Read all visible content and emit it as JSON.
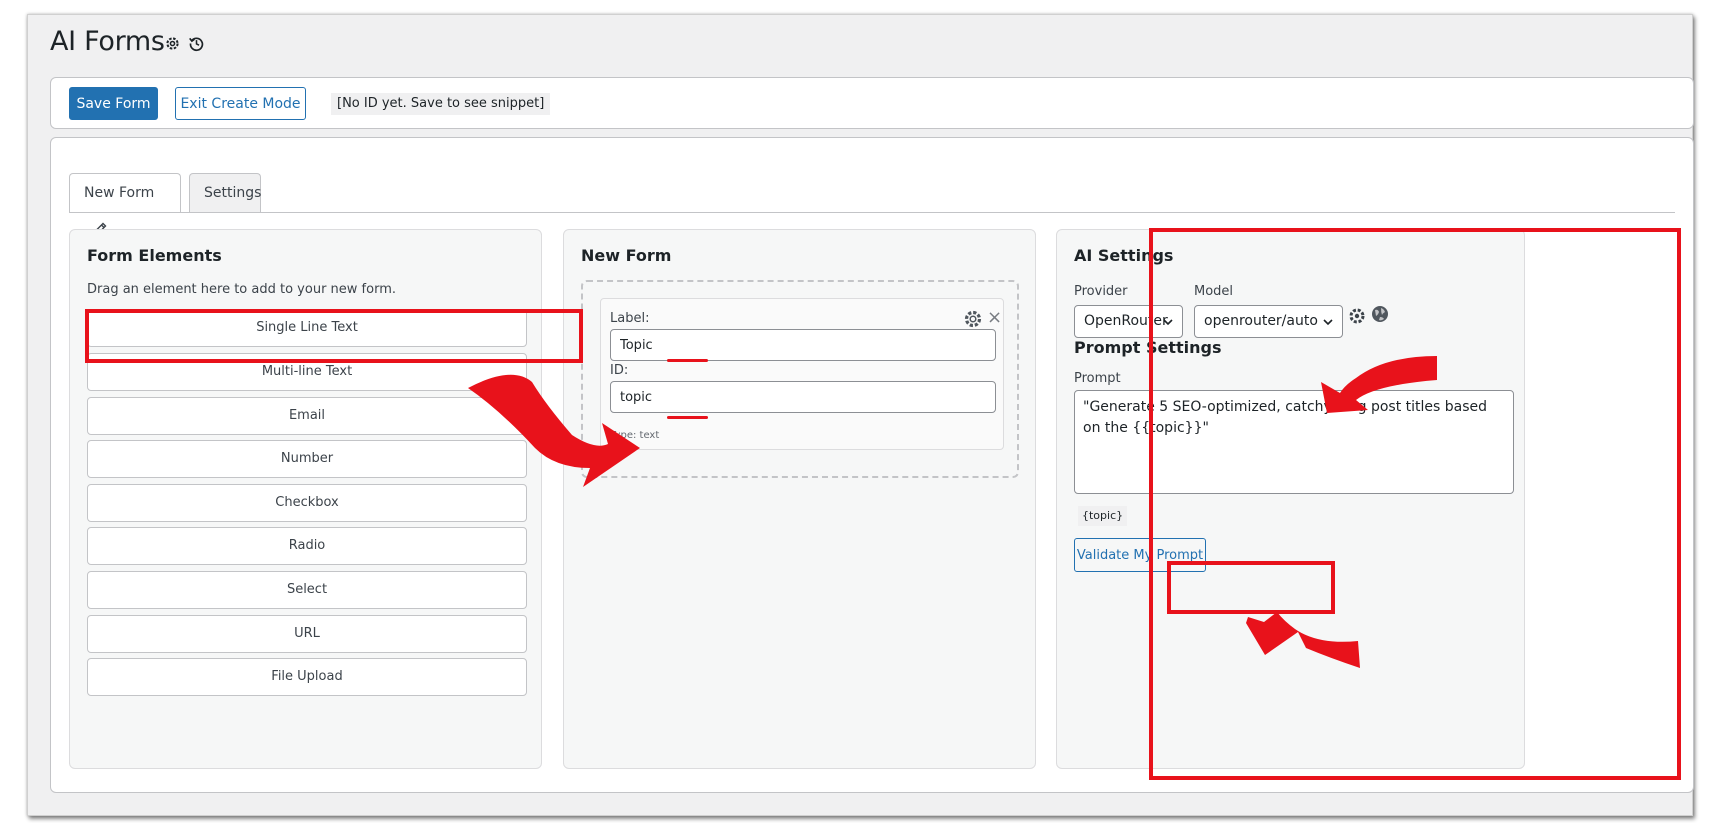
{
  "page": {
    "title": "AI Forms",
    "title_icons": [
      "gear-icon",
      "history-icon"
    ]
  },
  "toolbar": {
    "save_label": "Save Form",
    "exit_label": "Exit Create Mode",
    "snippet_text": "[No ID yet. Save to see snippet]"
  },
  "tabs": [
    {
      "label": "New Form",
      "icon": "pencil-icon",
      "active": true
    },
    {
      "label": "Settings",
      "active": false
    }
  ],
  "form_elements": {
    "title": "Form Elements",
    "hint": "Drag an element here to add to your new form.",
    "items": [
      "Single Line Text",
      "Multi-line Text",
      "Email",
      "Number",
      "Checkbox",
      "Radio",
      "Select",
      "URL",
      "File Upload"
    ]
  },
  "new_form": {
    "title": "New Form",
    "field": {
      "label_caption": "Label:",
      "label_value": "Topic",
      "id_caption": "ID:",
      "id_value": "topic",
      "type_text": "Type: text"
    }
  },
  "ai_settings": {
    "title": "AI Settings",
    "provider_label": "Provider",
    "provider_value": "OpenRouter",
    "model_label": "Model",
    "model_value": "openrouter/auto",
    "prompt_settings_title": "Prompt Settings",
    "prompt_label": "Prompt",
    "prompt_value": "\"Generate 5 SEO-optimized, catchy blog post titles based on the {{topic}}\"",
    "tag_chip": "{topic}",
    "validate_label": "Validate My Prompt"
  },
  "colors": {
    "accent": "#2271b1",
    "annotation_red": "#e8121b",
    "background": "#f0f0f1"
  }
}
